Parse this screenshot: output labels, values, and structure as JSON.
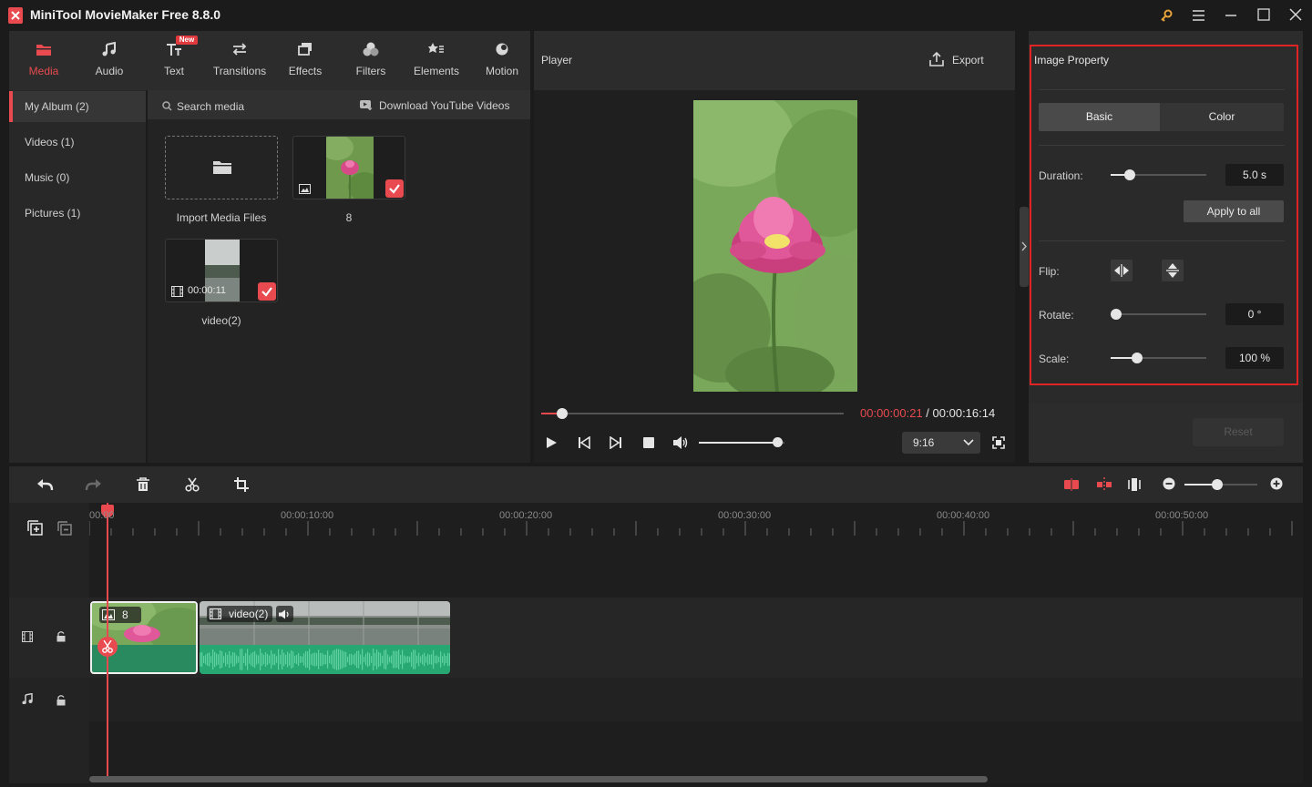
{
  "app": {
    "title": "MiniTool MovieMaker Free 8.8.0"
  },
  "toolbar": {
    "items": [
      {
        "label": "Media",
        "icon": "folder-icon",
        "active": true
      },
      {
        "label": "Audio",
        "icon": "music-note-icon"
      },
      {
        "label": "Text",
        "icon": "text-icon",
        "badge": "New"
      },
      {
        "label": "Transitions",
        "icon": "transitions-icon"
      },
      {
        "label": "Effects",
        "icon": "effects-icon"
      },
      {
        "label": "Filters",
        "icon": "filters-icon"
      },
      {
        "label": "Elements",
        "icon": "elements-icon"
      },
      {
        "label": "Motion",
        "icon": "motion-icon"
      }
    ]
  },
  "nav": {
    "items": [
      {
        "label": "My Album (2)",
        "active": true
      },
      {
        "label": "Videos (1)"
      },
      {
        "label": "Music (0)"
      },
      {
        "label": "Pictures (1)"
      }
    ]
  },
  "media": {
    "search_placeholder": "Search media",
    "download_label": "Download YouTube Videos",
    "import_label": "Import Media Files",
    "items": [
      {
        "label": "8",
        "type": "image"
      },
      {
        "label": "video(2)",
        "type": "video",
        "duration": "00:00:11"
      }
    ]
  },
  "player": {
    "title": "Player",
    "export_label": "Export",
    "current_time": "00:00:00:21",
    "separator": " / ",
    "total_time": "00:00:16:14",
    "progress": 0.07,
    "volume": 0.92,
    "aspect_ratio": "9:16"
  },
  "property": {
    "title": "Image Property",
    "tabs": [
      {
        "label": "Basic",
        "active": true
      },
      {
        "label": "Color"
      }
    ],
    "duration_label": "Duration:",
    "duration_value": "5.0 s",
    "duration_level": 0.2,
    "apply_all_label": "Apply to all",
    "flip_label": "Flip:",
    "rotate_label": "Rotate:",
    "rotate_value": "0 °",
    "rotate_level": 0.0,
    "scale_label": "Scale:",
    "scale_value": "100 %",
    "scale_level": 0.28,
    "reset_label": "Reset"
  },
  "timeline": {
    "ruler": [
      "00:00",
      "00:00:10:00",
      "00:00:20:00",
      "00:00:30:00",
      "00:00:40:00",
      "00:00:50:00"
    ],
    "clips": [
      {
        "label": "8",
        "type": "image"
      },
      {
        "label": "video(2)",
        "type": "video"
      }
    ],
    "zoom_level": 0.45
  },
  "colors": {
    "accent": "#e84a4f",
    "selection_border": "#e02424",
    "audio_wave": "#27a873"
  }
}
